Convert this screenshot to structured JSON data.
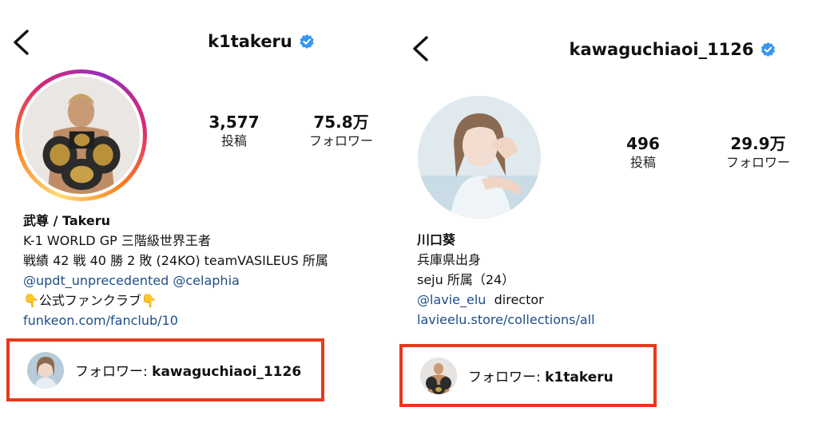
{
  "left": {
    "back_icon": "chevron-left-icon",
    "username": "k1takeru",
    "verified_icon": "verified-badge-icon",
    "stats": [
      {
        "value": "3,577",
        "label": "投稿"
      },
      {
        "value": "75.8万",
        "label": "フォロワー"
      }
    ],
    "bio": {
      "name": "武尊 / Takeru",
      "line1": "K-1 WORLD GP 三階級世界王者",
      "line2": "戦績 42 戦 40 勝 2 敗 (24KO) teamVASILEUS 所属",
      "mentions": "@updt_unprecedented @celaphia",
      "line4": "👇公式ファンクラブ👇",
      "link": "funkeon.com/fanclub/10"
    },
    "follower": {
      "prefix": "フォロワー: ",
      "account": "kawaguchiaoi_1126"
    }
  },
  "right": {
    "back_icon": "chevron-left-icon",
    "username": "kawaguchiaoi_1126",
    "verified_icon": "verified-badge-icon",
    "stats": [
      {
        "value": "496",
        "label": "投稿"
      },
      {
        "value": "29.9万",
        "label": "フォロワー"
      }
    ],
    "bio": {
      "name": "川口葵",
      "line1": "兵庫県出身",
      "line2": "seju 所属（24）",
      "mention": "@lavie_elu",
      "mention_suffix": "director",
      "link": "lavieelu.store/collections/all"
    },
    "follower": {
      "prefix": "フォロワー: ",
      "account": "k1takeru"
    }
  },
  "colors": {
    "highlight_border": "#e8381b",
    "verified_blue": "#3897f0",
    "link_blue": "#1e4e8a"
  }
}
